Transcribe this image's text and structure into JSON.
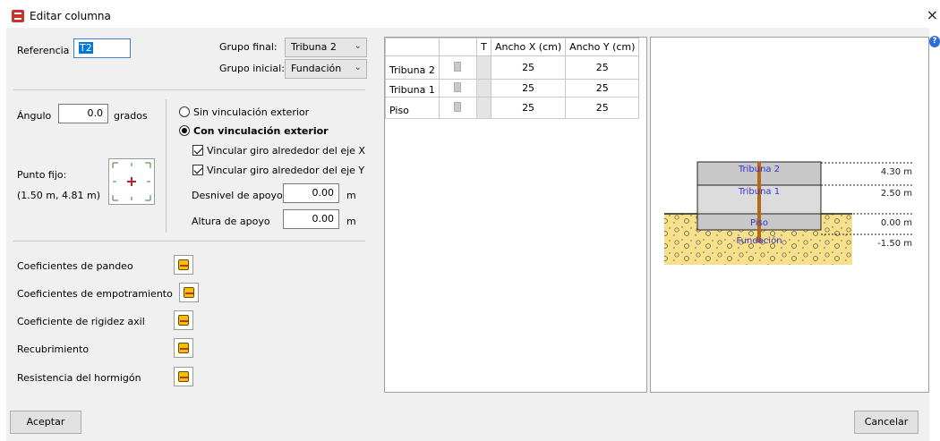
{
  "window": {
    "title": "Editar columna",
    "close": "×",
    "help": "?"
  },
  "header": {
    "referencia_label": "Referencia",
    "referencia_value": "T2",
    "grupo_final_label": "Grupo final:",
    "grupo_final_value": "Tribuna 2",
    "grupo_inicial_label": "Grupo inicial:",
    "grupo_inicial_value": "Fundación"
  },
  "angle": {
    "label": "Ángulo",
    "value": "0.0",
    "unit": "grados"
  },
  "fixed_point": {
    "label": "Punto fijo:",
    "coords": "(1.50 m, 4.81 m)"
  },
  "binding": {
    "sin_label": "Sin vinculación exterior",
    "con_label": "Con vinculación exterior",
    "selected": "con",
    "giro_x_label": "Vincular giro alrededor del eje X",
    "giro_x_checked": true,
    "giro_y_label": "Vincular giro alrededor del eje Y",
    "giro_y_checked": true,
    "desnivel_label": "Desnivel de apoyo",
    "desnivel_value": "0.00",
    "desnivel_unit": "m",
    "altura_label": "Altura de apoyo",
    "altura_value": "0.00",
    "altura_unit": "m"
  },
  "coefficients": [
    {
      "label": "Coeficientes de pandeo"
    },
    {
      "label": "Coeficientes de empotramiento"
    },
    {
      "label": "Coeficiente de rigidez axil"
    },
    {
      "label": "Recubrimiento"
    },
    {
      "label": "Resistencia del hormigón"
    }
  ],
  "table": {
    "headers": [
      "",
      "",
      "T",
      "Ancho X (cm)",
      "Ancho Y (cm)"
    ],
    "rows": [
      {
        "name": "Tribuna 2",
        "ancho_x": "25",
        "ancho_y": "25"
      },
      {
        "name": "Tribuna 1",
        "ancho_x": "25",
        "ancho_y": "25"
      },
      {
        "name": "Piso",
        "ancho_x": "25",
        "ancho_y": "25"
      }
    ]
  },
  "preview": {
    "levels": [
      {
        "name": "Tribuna 2",
        "elevation": "4.30 m"
      },
      {
        "name": "Tribuna 1",
        "elevation": "2.50 m"
      },
      {
        "name": "Piso",
        "elevation": "0.00 m"
      },
      {
        "name": "Fundación",
        "elevation": "-1.50 m"
      }
    ],
    "colors": {
      "level_fill_top": "#c8c8c8",
      "level_fill_mid": "#dcdcdc",
      "column": "#b8651e",
      "soil": "#f7e08a",
      "level_text": "#3333cc"
    }
  },
  "footer": {
    "accept": "Aceptar",
    "cancel": "Cancelar"
  }
}
